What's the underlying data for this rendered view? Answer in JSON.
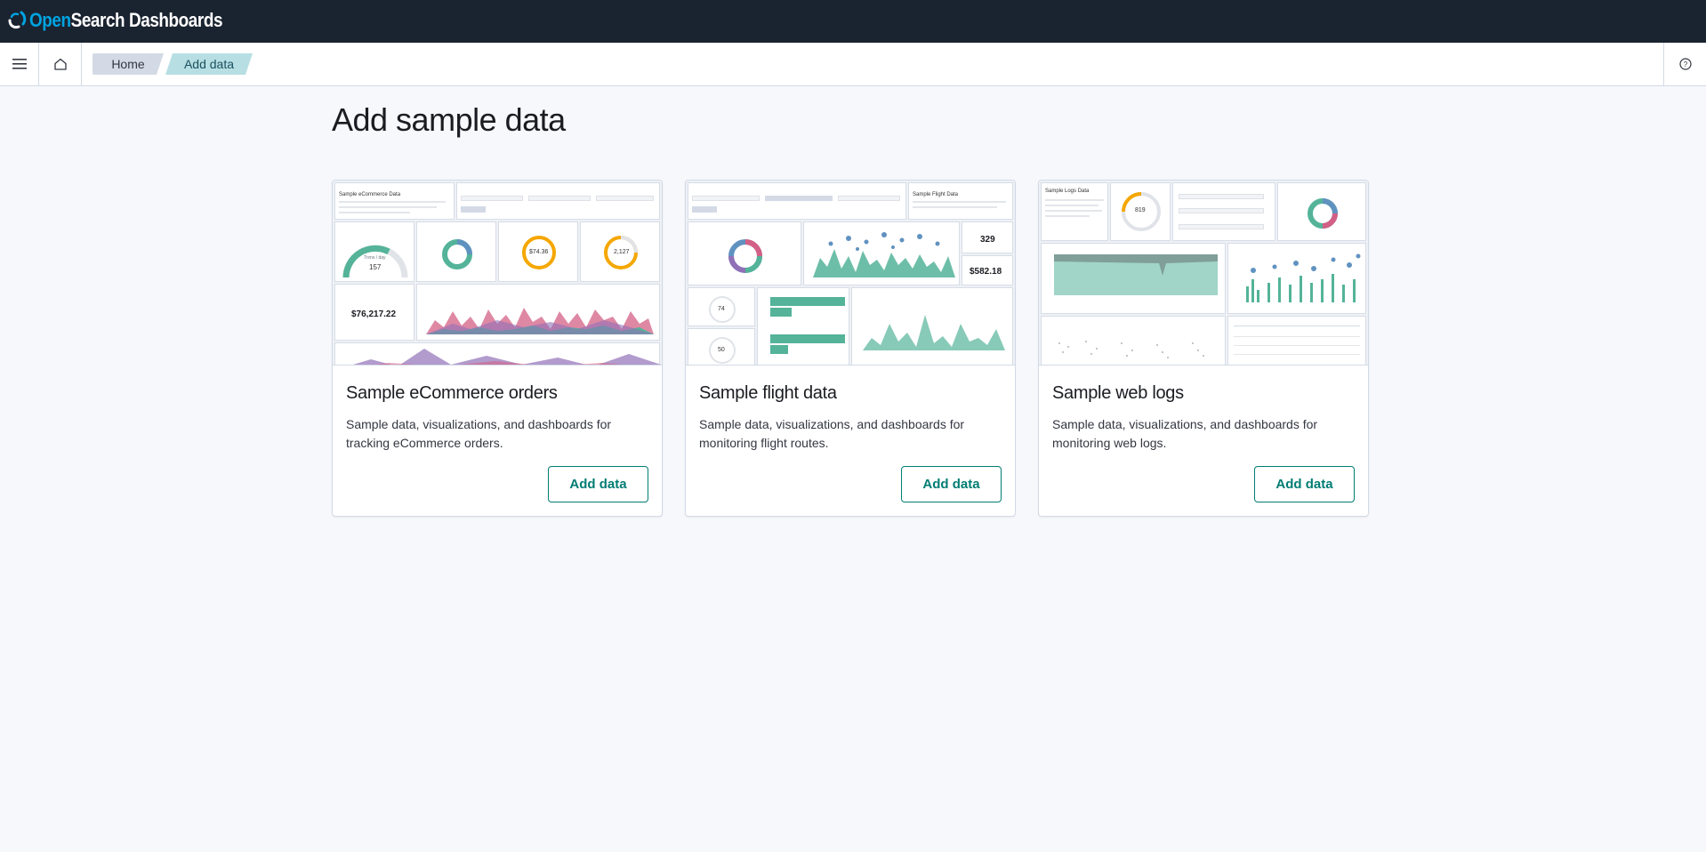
{
  "brand": {
    "open": "Open",
    "rest": "Search Dashboards"
  },
  "breadcrumbs": [
    {
      "label": "Home"
    },
    {
      "label": "Add data"
    }
  ],
  "page": {
    "title": "Add sample data"
  },
  "cards": [
    {
      "title": "Sample eCommerce orders",
      "description": "Sample data, visualizations, and dashboards for tracking eCommerce orders.",
      "button_label": "Add data",
      "preview": {
        "heading": "Sample eCommerce Data",
        "gauge_label": "Trxns / day",
        "gauge_value": "157",
        "donut_value": "$74.36",
        "donut_value_2": "2,127",
        "big_value": "$76,217.22"
      }
    },
    {
      "title": "Sample flight data",
      "description": "Sample data, visualizations, and dashboards for monitoring flight routes.",
      "button_label": "Add data",
      "preview": {
        "heading": "Sample Flight Data",
        "metric_1": "329",
        "metric_2": "$582.18",
        "gauge_1": "74",
        "gauge_2": "50"
      }
    },
    {
      "title": "Sample web logs",
      "description": "Sample data, visualizations, and dashboards for monitoring web logs.",
      "button_label": "Add data",
      "preview": {
        "heading": "Sample Logs Data",
        "gauge_value": "819"
      }
    }
  ],
  "icons": {
    "menu": "hamburger-menu-icon",
    "home": "home-icon",
    "help": "help-icon",
    "logo": "opensearch-logo-icon"
  },
  "colors": {
    "accent": "#017d73",
    "header": "#1a2330",
    "brand_blue": "#00a3e0",
    "chart_green": "#54b399"
  }
}
